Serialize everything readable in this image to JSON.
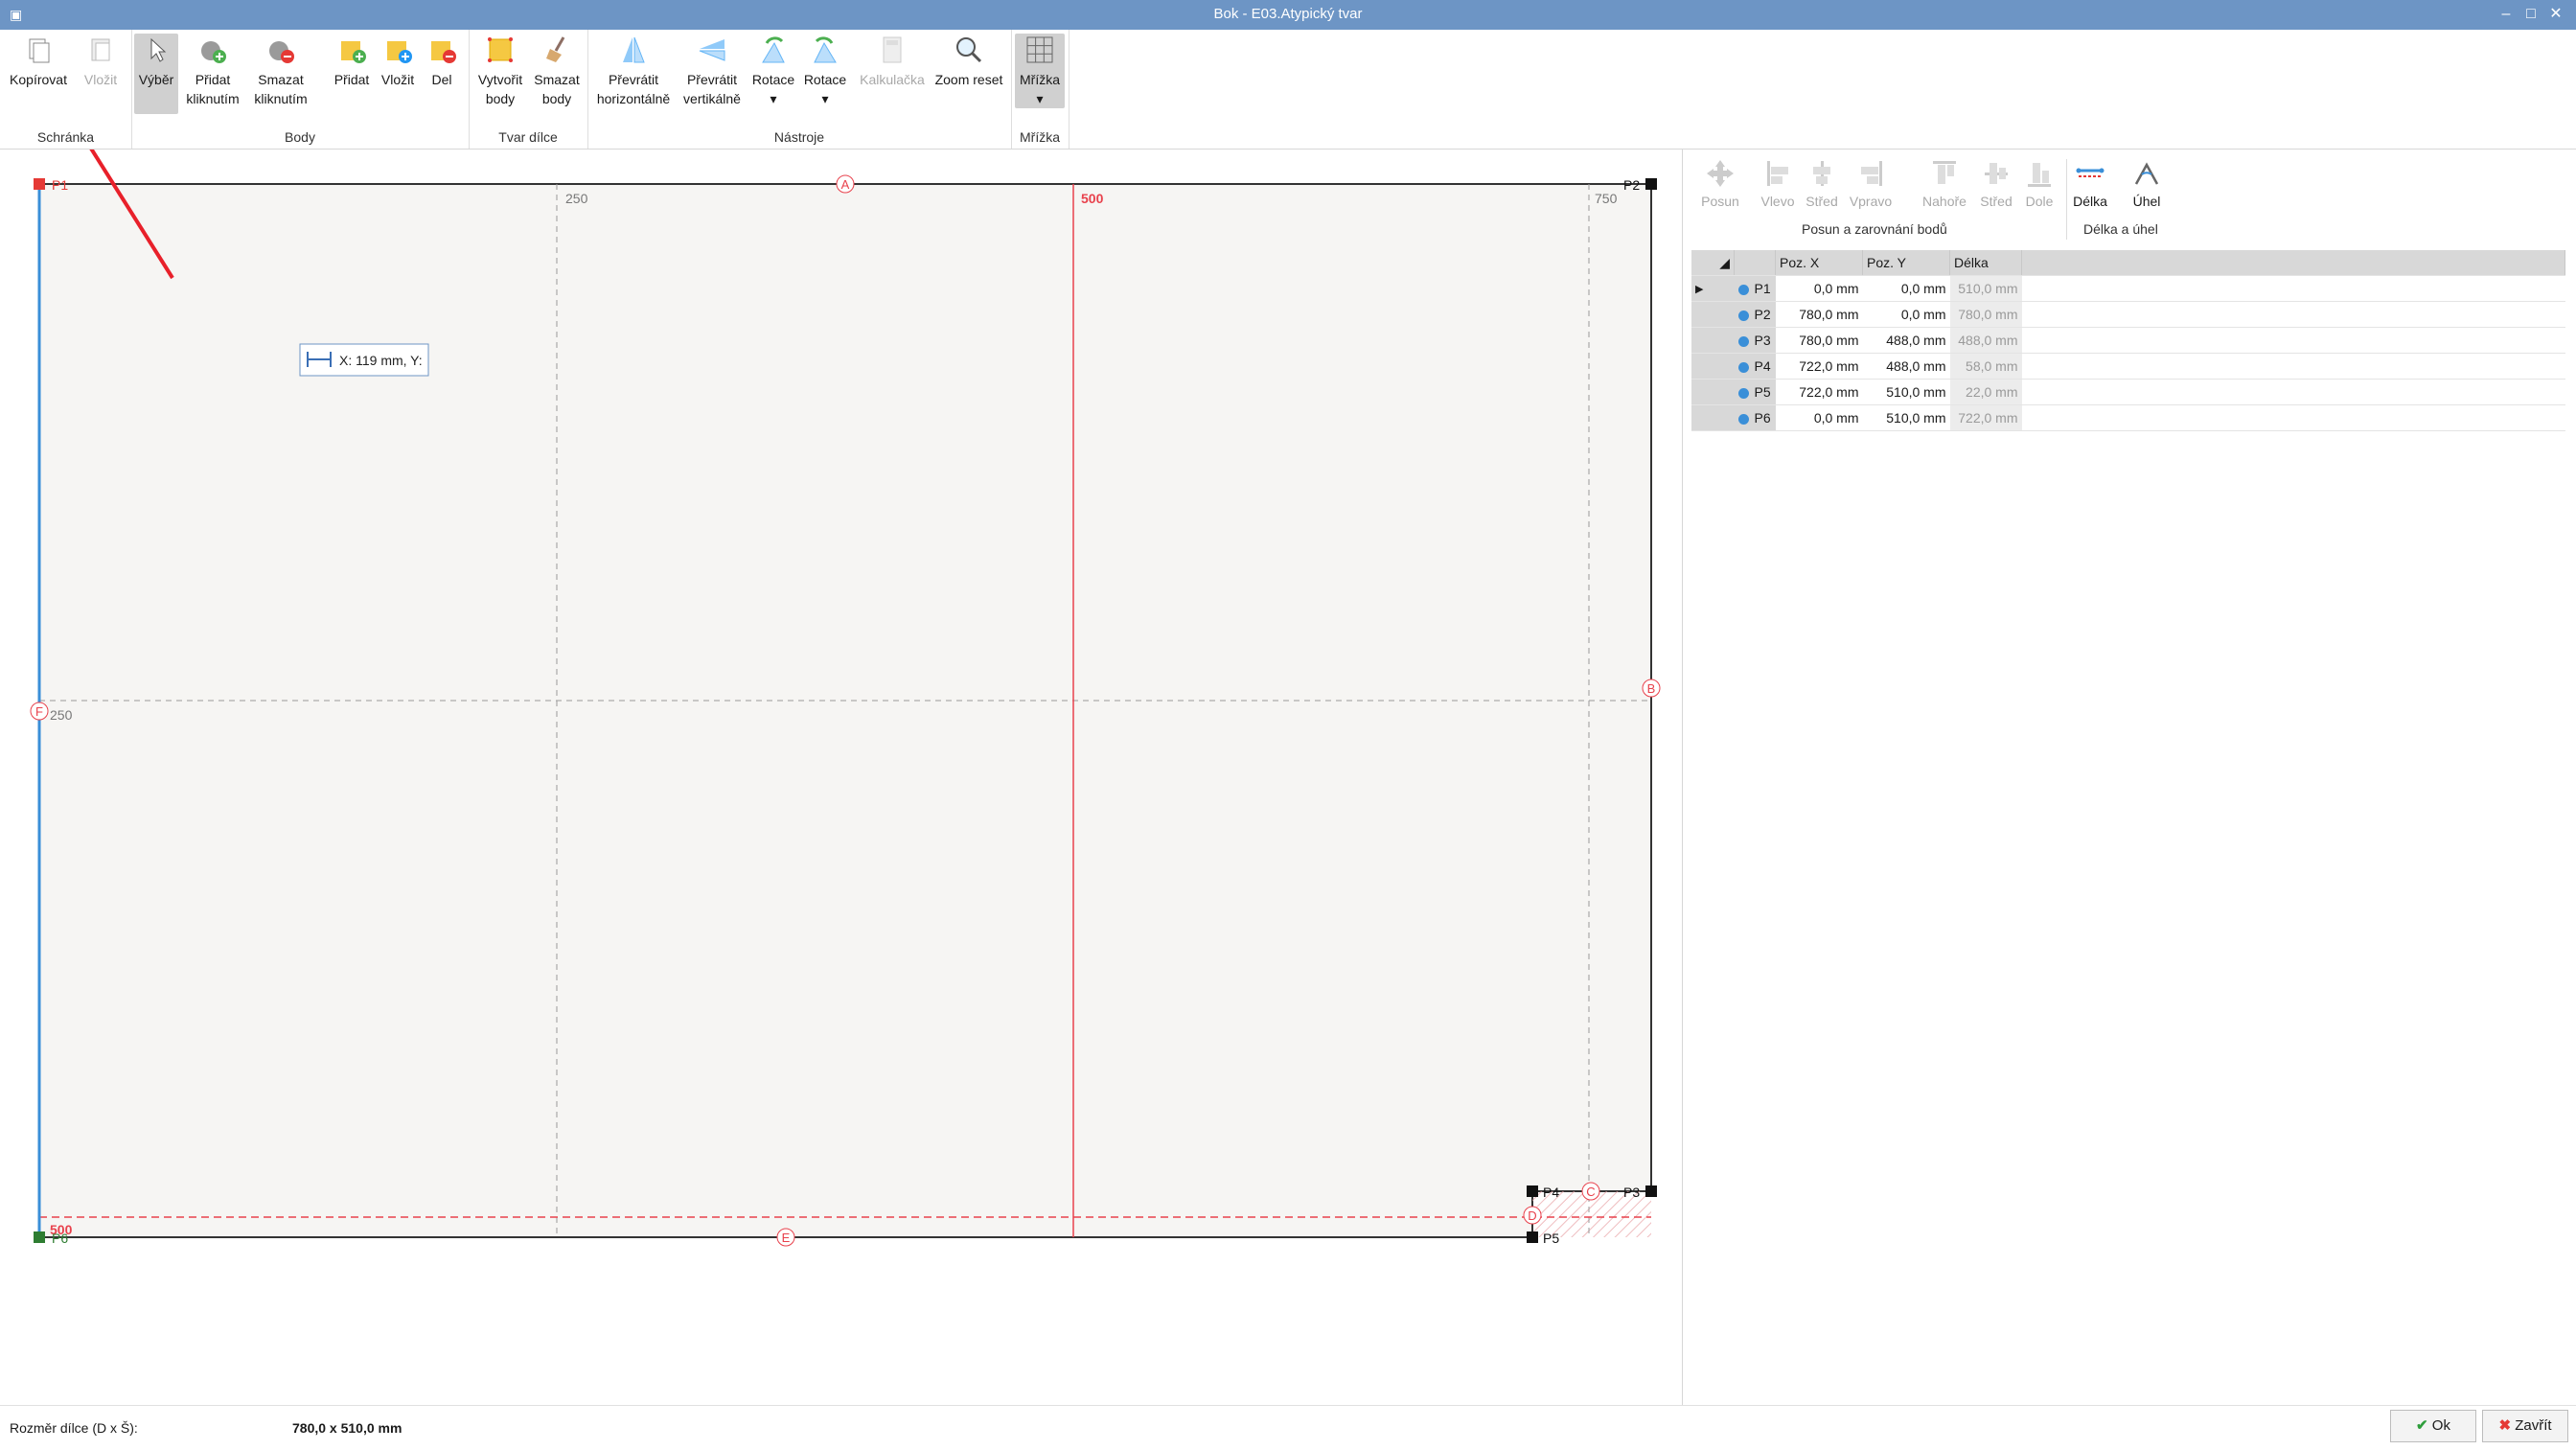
{
  "window": {
    "title": "Bok - E03.Atypický tvar"
  },
  "ribbon": {
    "groups": [
      {
        "label": "Schránka"
      },
      {
        "label": "Body"
      },
      {
        "label": "Tvar dílce"
      },
      {
        "label": "Nástroje"
      },
      {
        "label": "Mřížka"
      }
    ],
    "buttons": {
      "kopirovat": "Kopírovat",
      "vlozit": "Vložit",
      "vyber": "Výběr",
      "pridat_kliknutim": [
        "Přidat",
        "kliknutím"
      ],
      "smazat_kliknutim": [
        "Smazat",
        "kliknutím"
      ],
      "pridat": "Přidat",
      "vlozit2": "Vložit",
      "del": "Del",
      "vytvorit_body": [
        "Vytvořit",
        "body"
      ],
      "smazat_body": [
        "Smazat",
        "body"
      ],
      "prevratit_h": [
        "Převrátit",
        "horizontálně"
      ],
      "prevratit_v": [
        "Převrátit",
        "vertikálně"
      ],
      "rotace1": "Rotace",
      "rotace2": "Rotace",
      "kalkulacka": "Kalkulačka",
      "zoom_reset": "Zoom reset",
      "mrizka": "Mřížka"
    }
  },
  "canvas": {
    "guides": {
      "v250": "250",
      "v500": "500",
      "v750": "750",
      "h250": "250",
      "h500": "500"
    },
    "markers": {
      "a": "A",
      "b": "B",
      "c": "C",
      "d": "D",
      "e": "E",
      "f": "F"
    },
    "points": {
      "p1": "P1",
      "p2": "P2",
      "p3": "P3",
      "p4": "P4",
      "p5": "P5",
      "p6": "P6"
    },
    "tooltip": "X: 119 mm, Y:"
  },
  "right_panel": {
    "tools": {
      "posun": "Posun",
      "vlevo": "Vlevo",
      "stred1": "Střed",
      "vpravo": "Vpravo",
      "nahore": "Nahoře",
      "stred2": "Střed",
      "dole": "Dole",
      "delka": "Délka",
      "uhel": "Úhel"
    },
    "groups": {
      "posun": "Posun a zarovnání bodů",
      "delka": "Délka a úhel"
    },
    "table": {
      "headers": {
        "x": "Poz. X",
        "y": "Poz. Y",
        "len": "Délka"
      },
      "rows": [
        {
          "name": "P1",
          "x": "0,0 mm",
          "y": "0,0 mm",
          "len": "510,0 mm"
        },
        {
          "name": "P2",
          "x": "780,0 mm",
          "y": "0,0 mm",
          "len": "780,0 mm"
        },
        {
          "name": "P3",
          "x": "780,0 mm",
          "y": "488,0 mm",
          "len": "488,0 mm"
        },
        {
          "name": "P4",
          "x": "722,0 mm",
          "y": "488,0 mm",
          "len": "58,0 mm"
        },
        {
          "name": "P5",
          "x": "722,0 mm",
          "y": "510,0 mm",
          "len": "22,0 mm"
        },
        {
          "name": "P6",
          "x": "0,0 mm",
          "y": "510,0 mm",
          "len": "722,0 mm"
        }
      ]
    }
  },
  "status": {
    "label": "Rozměr dílce (D x Š):",
    "value": "780,0 x 510,0 mm"
  },
  "footer": {
    "ok": "Ok",
    "close": "Zavřít"
  },
  "colors": {
    "accent": "#6d95c5",
    "guide_red": "#e8414c",
    "edge_blue": "#3a8fd8",
    "canvas_bg": "#f6f5f3"
  }
}
